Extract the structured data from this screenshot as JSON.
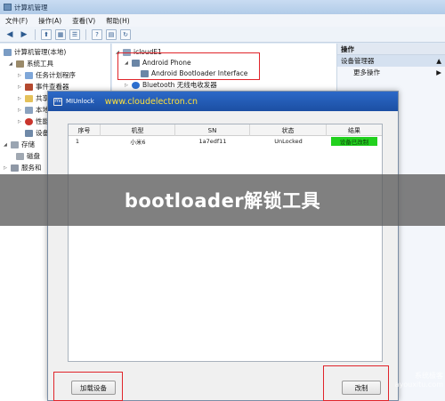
{
  "cm": {
    "title": "计算机管理",
    "menu": [
      {
        "label": "文件(F)"
      },
      {
        "label": "操作(A)"
      },
      {
        "label": "查看(V)"
      },
      {
        "label": "帮助(H)"
      }
    ],
    "toolbar_icons": [
      "back-arrow-icon",
      "forward-arrow-icon",
      "folder-up-icon",
      "panel-icon",
      "list-icon",
      "help-icon",
      "properties-icon",
      "refresh-icon"
    ],
    "tree": [
      {
        "label": "计算机管理(本地)"
      },
      {
        "label": "系统工具"
      },
      {
        "label": "任务计划程序"
      },
      {
        "label": "事件查看器"
      },
      {
        "label": "共享"
      },
      {
        "label": "本地"
      },
      {
        "label": "性能"
      },
      {
        "label": "设备"
      },
      {
        "label": "存储"
      },
      {
        "label": "磁盘"
      },
      {
        "label": "服务和"
      }
    ],
    "devices": {
      "root": "icloudE1",
      "android_phone": "Android Phone",
      "bootloader_interface": "Android Bootloader Interface",
      "bluetooth": "Bluetooth 无线电收发器"
    },
    "actions": {
      "header": "操作",
      "section": "设备管理器",
      "more": "更多操作"
    }
  },
  "mi": {
    "title": "MIUnlock",
    "url": "www.cloudelectron.cn",
    "logo": "mi",
    "columns": [
      "序号",
      "机型",
      "SN",
      "状态",
      "结果"
    ],
    "rows": [
      {
        "index": "1",
        "model": "小米6",
        "sn": "1a7edf11",
        "status": "UnLocked",
        "result": "设备已改制"
      }
    ],
    "load_button": "加载设备",
    "unlock_button": "改制",
    "result_color": "#22d11e"
  },
  "banner": {
    "text": "bootloader解锁工具"
  },
  "watermark": {
    "line1": "系统极客",
    "line2": "ayouxitu.com"
  },
  "colors": {
    "accent_red": "#e0242a",
    "mi_titlebar": "#1c4fa3",
    "url_yellow": "#ffe03a"
  }
}
